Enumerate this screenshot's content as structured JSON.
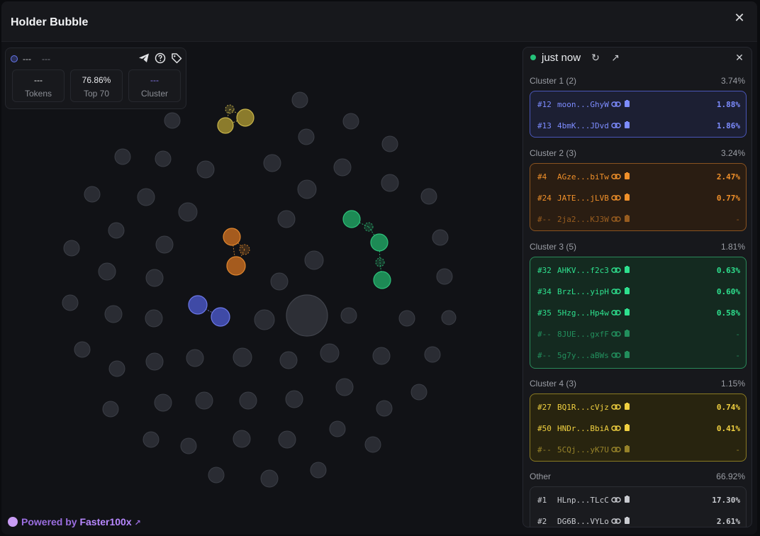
{
  "header": {
    "title": "Holder Bubble",
    "close": "✕"
  },
  "info": {
    "name": "---",
    "sub": "---",
    "icons": [
      "telegram-icon",
      "help-icon",
      "tag-icon"
    ],
    "stats": [
      {
        "value": "---",
        "label": "Tokens"
      },
      {
        "value": "76.86%",
        "label": "Top 70"
      },
      {
        "value": "---",
        "label": "Cluster"
      }
    ]
  },
  "powered": {
    "prefix": "Powered by ",
    "brand": "Faster100x",
    "link_icon": "↗"
  },
  "panel": {
    "time": "just now",
    "refresh_icon": "↻",
    "open_icon": "↗",
    "close_icon": "✕",
    "clusters": [
      {
        "title": "Cluster 1 (2)",
        "pct": "3.74%",
        "color": "#7d8cff",
        "bg": "#1c1f33",
        "border": "#4a56b8",
        "rows": [
          {
            "rank": "#12",
            "addr": "moon...GhyW",
            "pct": "1.88%",
            "dim": false
          },
          {
            "rank": "#13",
            "addr": "4bmK...JDvd",
            "pct": "1.86%",
            "dim": false
          }
        ]
      },
      {
        "title": "Cluster 2 (3)",
        "pct": "3.24%",
        "color": "#f0902a",
        "bg": "#2a1d12",
        "border": "#8a5320",
        "rows": [
          {
            "rank": "#4",
            "addr": "AGze...biTw",
            "pct": "2.47%",
            "dim": false
          },
          {
            "rank": "#24",
            "addr": "JATE...jLVB",
            "pct": "0.77%",
            "dim": false
          },
          {
            "rank": "#--",
            "addr": "2ja2...KJ3W",
            "pct": "-",
            "dim": true
          }
        ]
      },
      {
        "title": "Cluster 3 (5)",
        "pct": "1.81%",
        "color": "#2ee08e",
        "bg": "#142a20",
        "border": "#2a8a5a",
        "rows": [
          {
            "rank": "#32",
            "addr": "AHKV...f2c3",
            "pct": "0.63%",
            "dim": false
          },
          {
            "rank": "#34",
            "addr": "BrzL...yipH",
            "pct": "0.60%",
            "dim": false
          },
          {
            "rank": "#35",
            "addr": "5Hzg...Hp4w",
            "pct": "0.58%",
            "dim": false
          },
          {
            "rank": "#--",
            "addr": "8JUE...gxfF",
            "pct": "-",
            "dim": true
          },
          {
            "rank": "#--",
            "addr": "5g7y...aBWs",
            "pct": "-",
            "dim": true
          }
        ]
      },
      {
        "title": "Cluster 4 (3)",
        "pct": "1.15%",
        "color": "#f0d040",
        "bg": "#28240f",
        "border": "#8a7a22",
        "rows": [
          {
            "rank": "#27",
            "addr": "BQ1R...cVjz",
            "pct": "0.74%",
            "dim": false
          },
          {
            "rank": "#50",
            "addr": "HNDr...BbiA",
            "pct": "0.41%",
            "dim": false
          },
          {
            "rank": "#--",
            "addr": "5CQj...yK7U",
            "pct": "-",
            "dim": true
          }
        ]
      },
      {
        "title": "Other",
        "pct": "66.92%",
        "color": "#c9cbd0",
        "bg": "#1a1b1f",
        "border": "#2c2e34",
        "rows": [
          {
            "rank": "#1",
            "addr": "HLnp...TLcC",
            "pct": "17.30%",
            "dim": false
          },
          {
            "rank": "#2",
            "addr": "DG6B...VYLo",
            "pct": "2.61%",
            "dim": false
          }
        ]
      }
    ]
  }
}
